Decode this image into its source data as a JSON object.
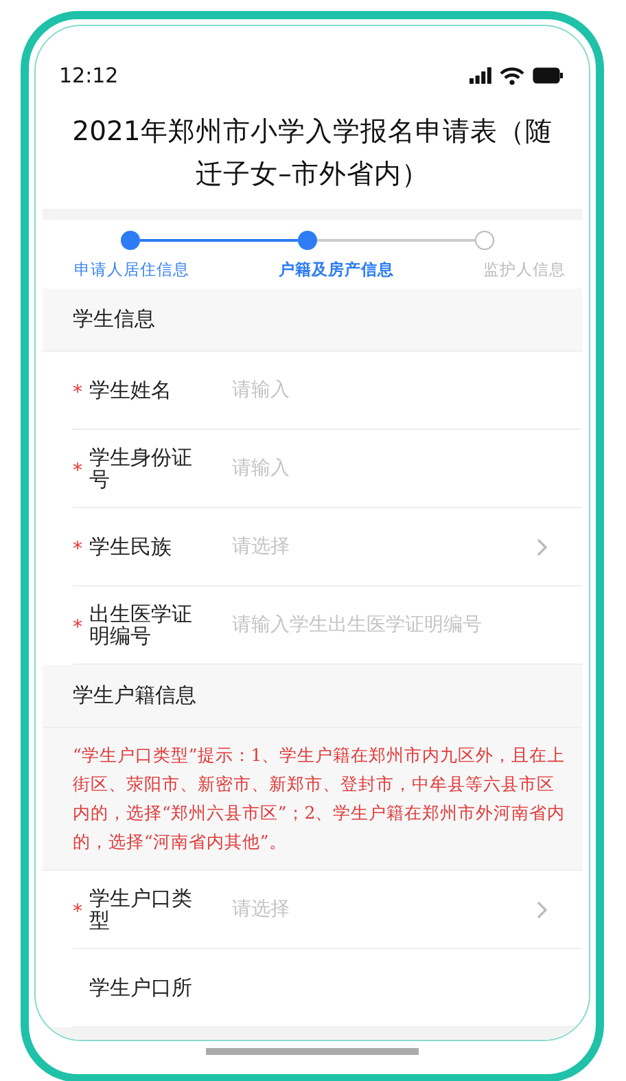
{
  "status_bar": {
    "time": "12:12"
  },
  "title": "2021年郑州市小学入学报名申请表（随迁子女–市外省内）",
  "steps": [
    {
      "label": "申请人居住信息",
      "done": true,
      "selected": false
    },
    {
      "label": "户籍及房产信息",
      "done": true,
      "selected": true
    },
    {
      "label": "监护人信息",
      "done": false,
      "selected": false
    }
  ],
  "sections": [
    {
      "title": "学生信息",
      "fields": [
        {
          "marker": "*",
          "label": "学生姓名",
          "placeholder": "请输入",
          "kind": "input"
        },
        {
          "marker": "*",
          "label": "学生身份证号",
          "placeholder": "请输入",
          "kind": "input"
        },
        {
          "marker": "*",
          "label": "学生民族",
          "placeholder": "请选择",
          "kind": "select"
        },
        {
          "marker": "*",
          "label": "出生医学证明编号",
          "placeholder": "请输入学生出生医学证明编号",
          "kind": "input"
        }
      ]
    },
    {
      "title": "学生户籍信息",
      "notice": "“学生户口类型”提示：1、学生户籍在郑州市内九区外，且在上街区、荥阳市、新密市、新郑市、登封市，中牟县等六县市区内的，选择“郑州六县市区”；2、学生户籍在郑州市外河南省内的，选择“河南省内其他”。",
      "fields": [
        {
          "marker": "*",
          "label": "学生户口类型",
          "placeholder": "请选择",
          "kind": "select"
        },
        {
          "label": "学生户口所",
          "kind": "input"
        }
      ]
    }
  ]
}
